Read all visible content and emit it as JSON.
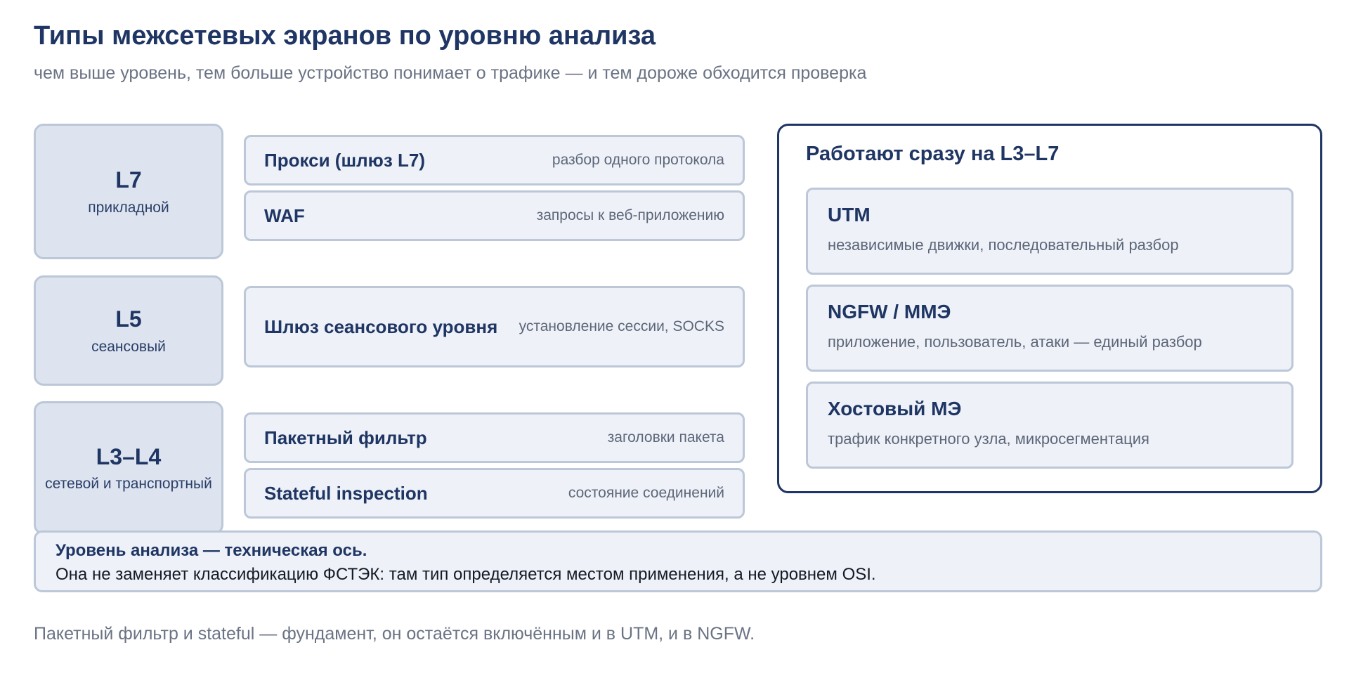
{
  "header": {
    "title": "Типы межсетевых экранов по уровню анализа",
    "subtitle": "чем выше уровень, тем больше устройство понимает о трафике — и тем дороже обходится проверка"
  },
  "levels": [
    {
      "code": "L7",
      "name": "прикладной",
      "firewalls": [
        {
          "name": "Прокси (шлюз L7)",
          "desc": "разбор одного протокола"
        },
        {
          "name": "WAF",
          "desc": "запросы к веб-приложению"
        }
      ]
    },
    {
      "code": "L5",
      "name": "сеансовый",
      "firewalls": [
        {
          "name": "Шлюз сеансового уровня",
          "desc": "установление сессии, SOCKS"
        }
      ]
    },
    {
      "code": "L3–L4",
      "name": "сетевой и транспортный",
      "firewalls": [
        {
          "name": "Пакетный фильтр",
          "desc": "заголовки пакета"
        },
        {
          "name": "Stateful inspection",
          "desc": "состояние соединений"
        }
      ]
    }
  ],
  "multilevel": {
    "title": "Работают сразу на L3–L7",
    "items": [
      {
        "name": "UTM",
        "desc": "независимые движки, последовательный разбор"
      },
      {
        "name": "NGFW / ММЭ",
        "desc": "приложение, пользователь, атаки — единый разбор"
      },
      {
        "name": "Хостовый МЭ",
        "desc": "трафик конкретного узла, микросегментация"
      }
    ]
  },
  "note": {
    "bold": "Уровень анализа — техническая ось.",
    "text": "Она не заменяет классификацию ФСТЭК: там тип определяется местом применения, а не уровнем OSI."
  },
  "footer": "Пакетный фильтр и stateful — фундамент, он остаётся включённым и в UTM, и в NGFW.",
  "colors": {
    "navy": "#1f3563",
    "level_fill": "#dde4ef",
    "card_fill": "#eef2f8",
    "border": "#bcc7d8",
    "muted_text": "#6a7384"
  }
}
